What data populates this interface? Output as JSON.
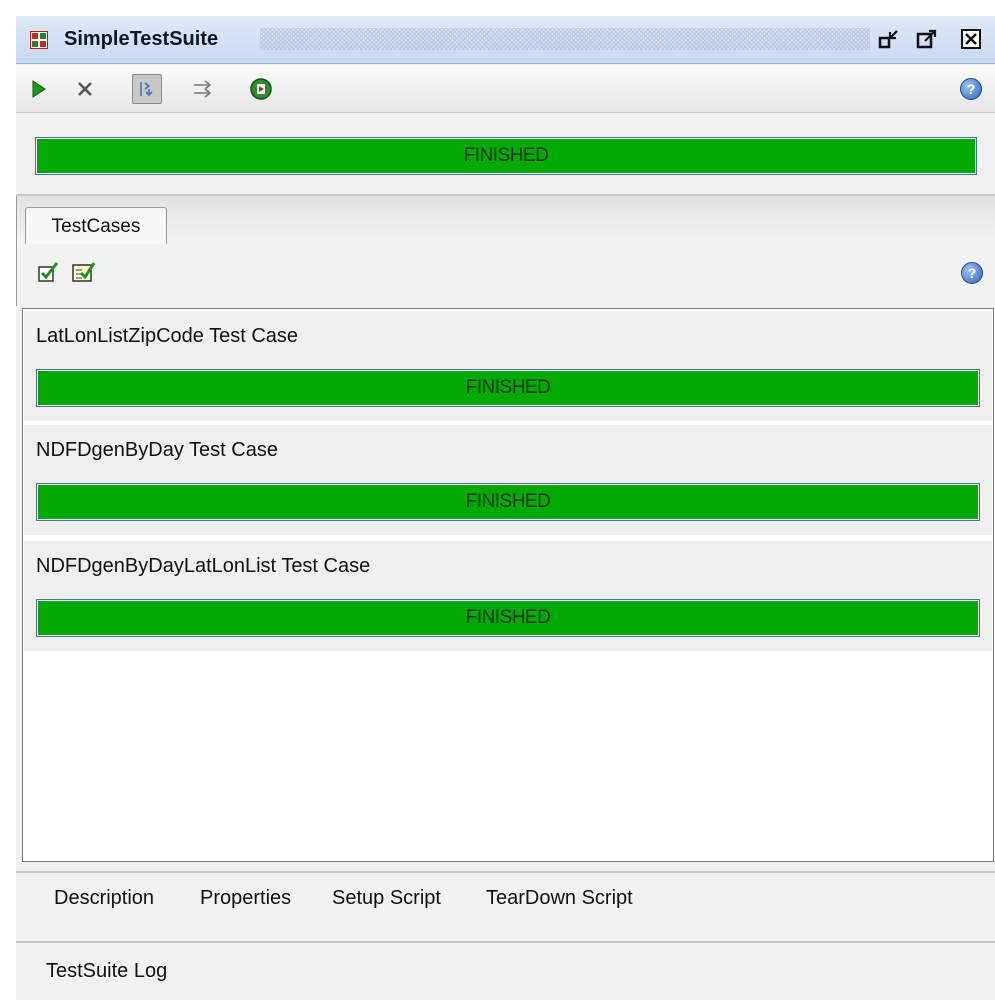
{
  "window": {
    "title": "SimpleTestSuite"
  },
  "toolbar": {
    "items": [
      "run-icon",
      "cancel-icon",
      "sequential-icon",
      "parallel-icon",
      "loadtest-icon",
      "help-icon"
    ]
  },
  "suite_progress": {
    "status": "FINISHED",
    "percent": 100,
    "color": "#00aa00"
  },
  "tabs": {
    "testcases": "TestCases"
  },
  "test_cases": [
    {
      "name": "LatLonListZipCode Test Case",
      "status": "FINISHED",
      "percent": 100
    },
    {
      "name": "NDFDgenByDay Test Case",
      "status": "FINISHED",
      "percent": 100
    },
    {
      "name": "NDFDgenByDayLatLonList Test Case",
      "status": "FINISHED",
      "percent": 100
    }
  ],
  "bottom_tabs": {
    "description": "Description",
    "properties": "Properties",
    "setup_script": "Setup Script",
    "teardown_script": "TearDown Script"
  },
  "log": {
    "label": "TestSuite Log"
  },
  "colors": {
    "title_bar": "#c9d9f1",
    "progress_fill": "#00aa00",
    "progress_border": "#4f6ea0"
  }
}
